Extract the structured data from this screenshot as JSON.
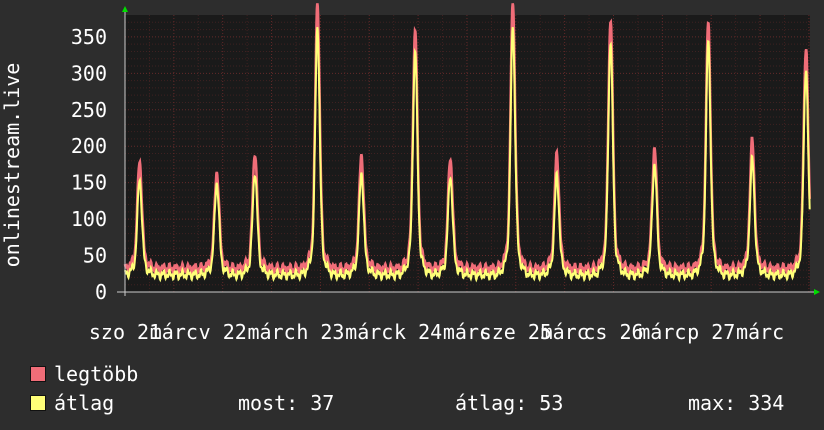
{
  "chart_data": {
    "type": "area",
    "ylabel": "onlinestream.live",
    "ylim": [
      0,
      380
    ],
    "yticks": [
      0,
      50,
      100,
      150,
      200,
      250,
      300,
      350
    ],
    "grid": true,
    "x_tick_labels": [
      {
        "label": "szo 21",
        "day": 0
      },
      {
        "label": "márc",
        "day": 0.5
      },
      {
        "label": "v 22",
        "day": 1
      },
      {
        "label": "márc",
        "day": 1.5
      },
      {
        "label": "h 23",
        "day": 2
      },
      {
        "label": "márc",
        "day": 2.5
      },
      {
        "label": "k 24",
        "day": 3
      },
      {
        "label": "márc",
        "day": 3.5
      },
      {
        "label": "sze 25",
        "day": 4
      },
      {
        "label": "márc",
        "day": 4.5
      },
      {
        "label": "cs 26",
        "day": 5
      },
      {
        "label": "márc",
        "day": 5.5
      },
      {
        "label": "p 27",
        "day": 6
      },
      {
        "label": "márc",
        "day": 6.5
      }
    ],
    "series": [
      {
        "name": "legtöbb",
        "color": "#f06d78",
        "peaks": [
          {
            "day": 0.15,
            "value": 160
          },
          {
            "day": 0.94,
            "value": 148
          },
          {
            "day": 1.33,
            "value": 172
          },
          {
            "day": 1.97,
            "value": 355
          },
          {
            "day": 2.42,
            "value": 168
          },
          {
            "day": 2.97,
            "value": 320
          },
          {
            "day": 3.33,
            "value": 165
          },
          {
            "day": 3.97,
            "value": 355
          },
          {
            "day": 4.42,
            "value": 168
          },
          {
            "day": 4.97,
            "value": 335
          },
          {
            "day": 5.42,
            "value": 178
          },
          {
            "day": 5.97,
            "value": 330
          },
          {
            "day": 6.42,
            "value": 185
          },
          {
            "day": 6.97,
            "value": 302
          }
        ]
      },
      {
        "name": "átlag",
        "color": "#ffff78",
        "peaks": [
          {
            "day": 0.15,
            "value": 145
          },
          {
            "day": 0.94,
            "value": 142
          },
          {
            "day": 1.33,
            "value": 155
          },
          {
            "day": 1.97,
            "value": 333
          },
          {
            "day": 2.42,
            "value": 153
          },
          {
            "day": 2.97,
            "value": 302
          },
          {
            "day": 3.33,
            "value": 150
          },
          {
            "day": 3.97,
            "value": 333
          },
          {
            "day": 4.42,
            "value": 150
          },
          {
            "day": 4.97,
            "value": 315
          },
          {
            "day": 5.42,
            "value": 165
          },
          {
            "day": 5.97,
            "value": 315
          },
          {
            "day": 6.42,
            "value": 170
          },
          {
            "day": 6.97,
            "value": 283
          }
        ]
      }
    ],
    "baseline": 32
  },
  "legend": {
    "max_label": "legtöbb",
    "avg_label": "átlag",
    "max_color": "#f06d78",
    "avg_color": "#ffff78"
  },
  "stats": {
    "current": "most: 37",
    "average": "átlag: 53",
    "maximum": "max: 334"
  },
  "colors": {
    "background": "#2d2d2d",
    "plot": "#1a1a1a",
    "grid": "#6b2b2b",
    "axis": "#cccccc",
    "arrow": "#00dd00"
  }
}
